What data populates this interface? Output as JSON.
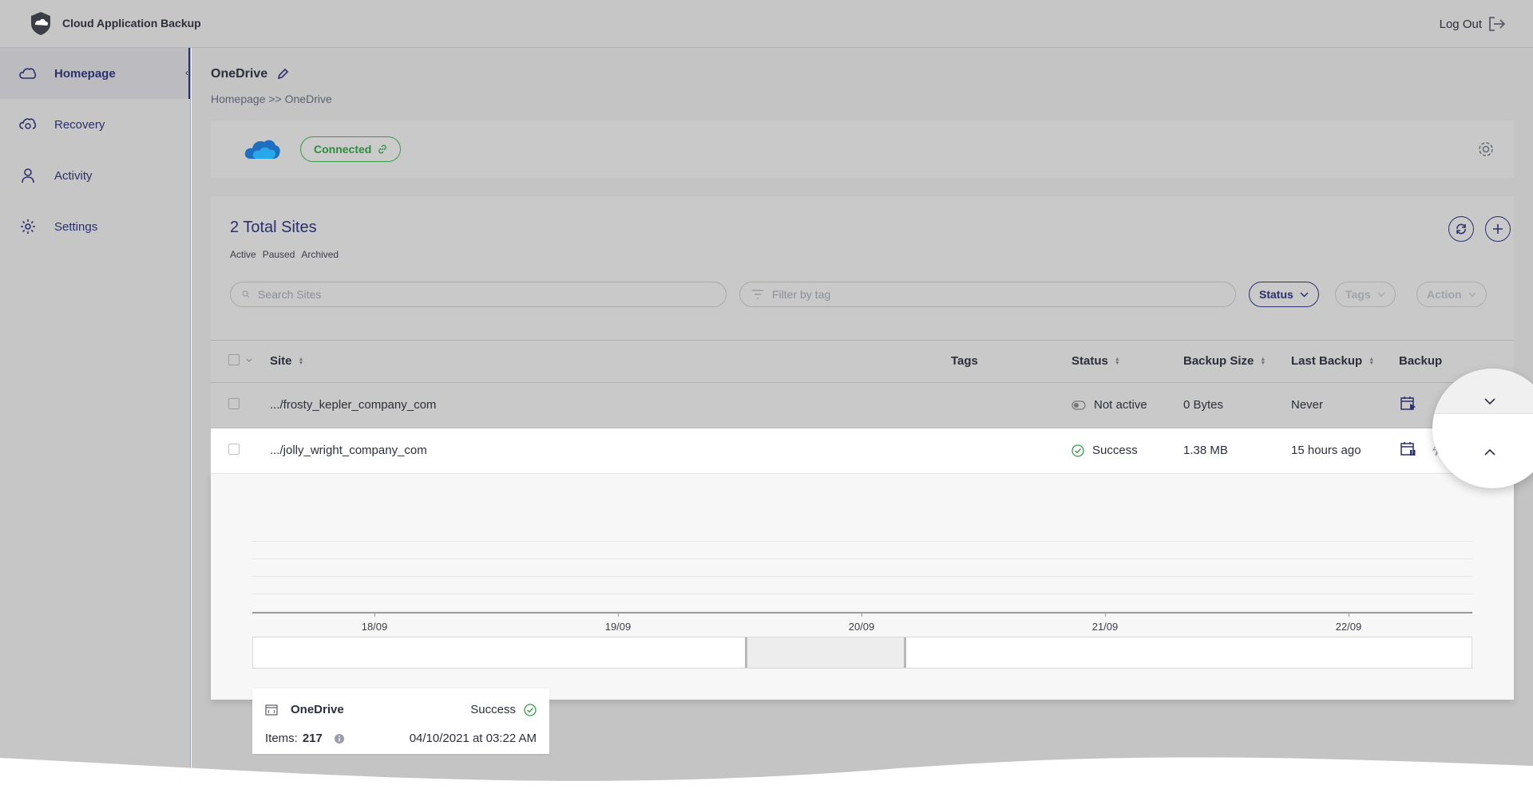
{
  "app": {
    "title": "Cloud Application Backup",
    "logout_label": "Log Out"
  },
  "sidebar": {
    "items": [
      {
        "label": "Homepage",
        "icon": "cloud-icon",
        "active": true
      },
      {
        "label": "Recovery",
        "icon": "cloud-restore-icon",
        "active": false
      },
      {
        "label": "Activity",
        "icon": "user-icon",
        "active": false
      },
      {
        "label": "Settings",
        "icon": "gear-icon",
        "active": false
      }
    ]
  },
  "page": {
    "title": "OneDrive",
    "breadcrumb": "Homepage >> OneDrive",
    "connection_status": "Connected"
  },
  "sites": {
    "total_label": "2 Total Sites",
    "filters": [
      "Active",
      "Paused",
      "Archived"
    ],
    "search_placeholder": "Search Sites",
    "tag_placeholder": "Filter by tag",
    "buttons": {
      "status": "Status",
      "tags": "Tags",
      "action": "Action"
    }
  },
  "table": {
    "columns": {
      "site": "Site",
      "tags": "Tags",
      "status": "Status",
      "backup_size": "Backup Size",
      "last_backup": "Last Backup",
      "backup": "Backup"
    },
    "rows": [
      {
        "site": ".../frosty_kepler_company_com",
        "status": "Not active",
        "backup_size": "0 Bytes",
        "last_backup": "Never"
      },
      {
        "site": ".../jolly_wright_company_com",
        "status": "Success",
        "backup_size": "1.38 MB",
        "last_backup": "15 hours ago"
      }
    ]
  },
  "timeline": {
    "ticks": [
      "18/09",
      "19/09",
      "20/09",
      "21/09",
      "22/09"
    ]
  },
  "detail_card": {
    "name": "OneDrive",
    "status": "Success",
    "items_label": "Items:",
    "items_count": "217",
    "date": "04/10/2021 at 03:22 AM"
  },
  "colors": {
    "accent": "#2b2f6b",
    "success": "#3a9a4a",
    "onedrive_blue": "#1e6fbf"
  }
}
